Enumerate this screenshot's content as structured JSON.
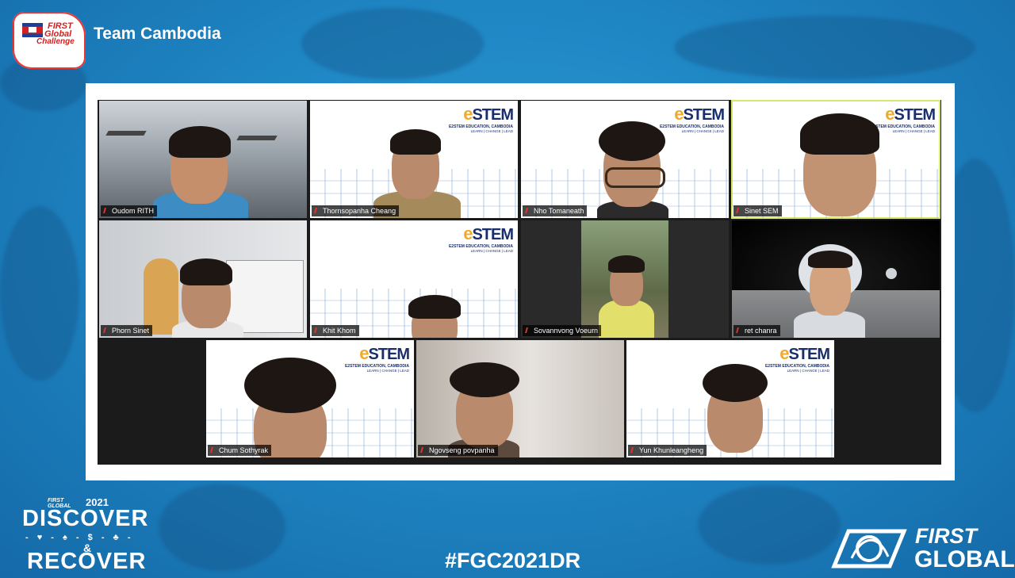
{
  "header": {
    "team_title": "Team Cambodia",
    "badge_line1": "FIRST",
    "badge_line2": "Global",
    "badge_line3": "Challenge"
  },
  "estem": {
    "logo": "STEM",
    "logo_e": "e",
    "sub": "E2STEM EDUCATION, CAMBODIA",
    "tag": "LEARN | CHANGE | LEAD"
  },
  "participants": [
    "Oudom RITH",
    "Thornsopanha Cheang",
    "Nho Tomaneath",
    "Sinet SEM",
    "Phorn Sinet",
    "Khit Khom",
    "Sovannvong Voeurn",
    "ret chanra",
    "Chum Sothyrak",
    "Ngovseng povpanha",
    "Yun Khunleangheng"
  ],
  "footer": {
    "event_small": "FIRST GLOBAL",
    "event_year": "2021",
    "event_line1": "DISCOVER",
    "event_mid": "- ♥ - ♠ - $ - ♣ -",
    "event_amp": "&",
    "event_line2": "RECOVER",
    "hashtag": "#FGC2021DR",
    "brand_line1": "FIRST",
    "brand_line2": "GLOBAL"
  },
  "colors": {
    "background": "#1f86c4",
    "selected_border": "#d6e86a",
    "name_icon": "#e0342b"
  }
}
